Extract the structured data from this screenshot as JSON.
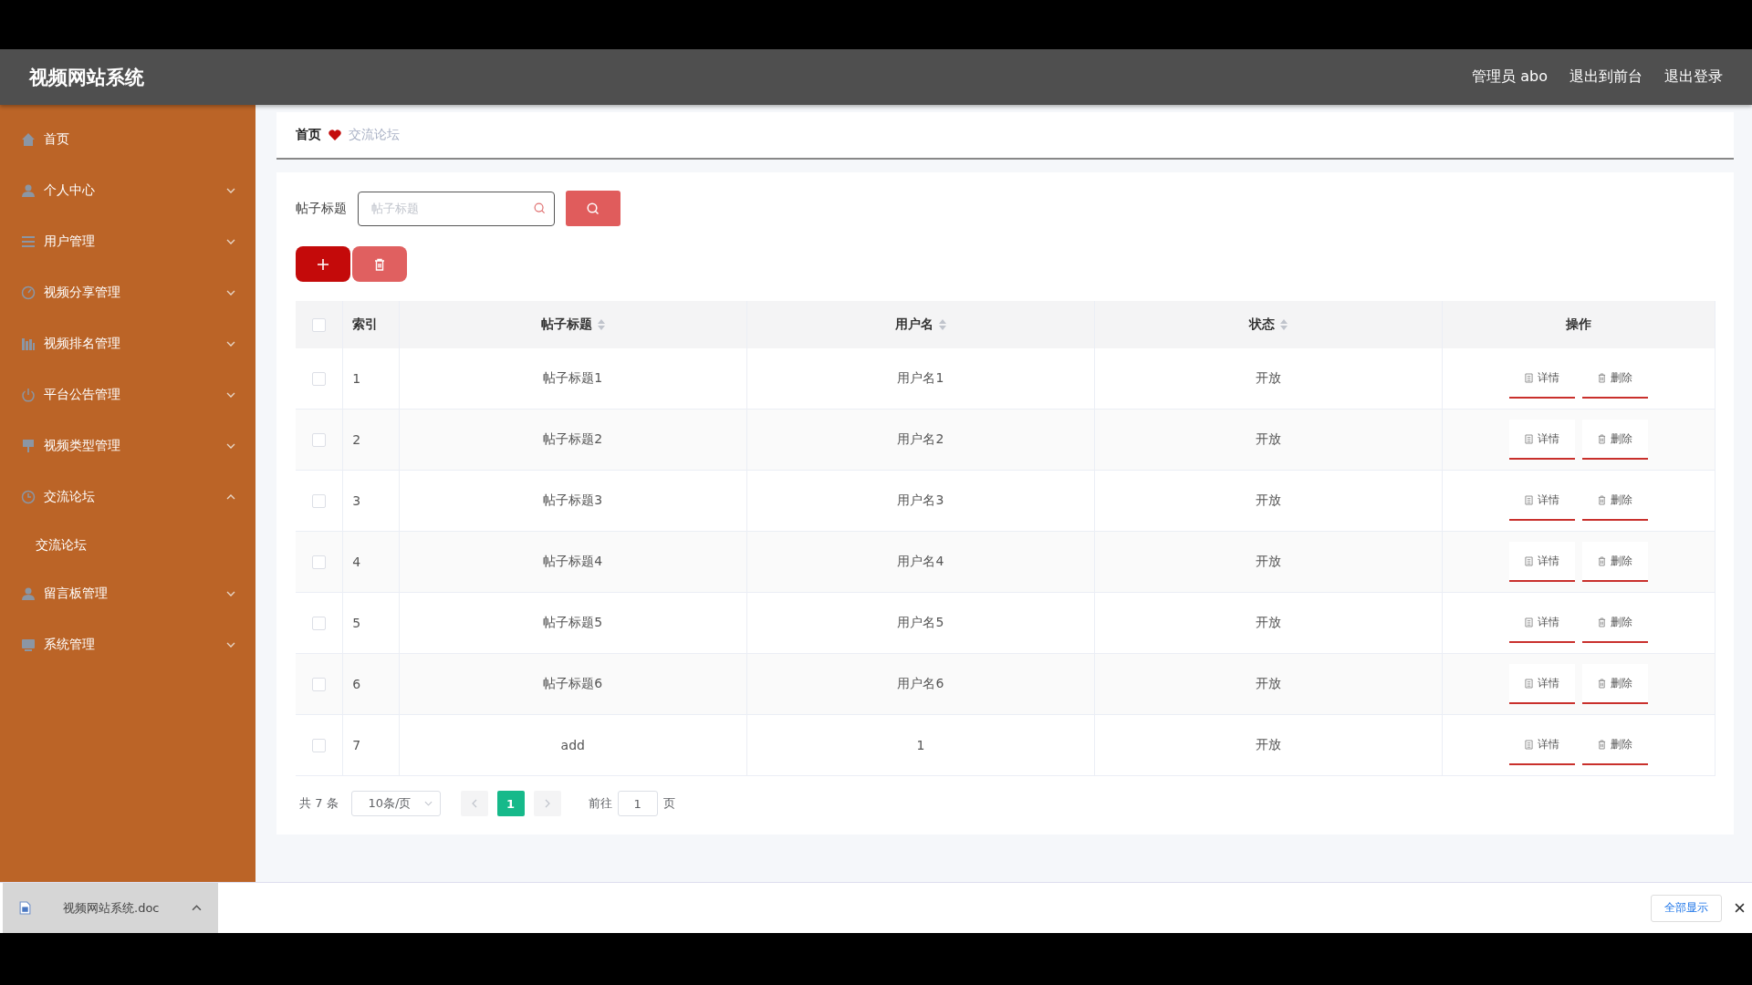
{
  "header": {
    "title": "视频网站系统",
    "user": "管理员 abo",
    "links": [
      "退出到前台",
      "退出登录"
    ]
  },
  "sidebar": {
    "items": [
      {
        "label": "首页"
      },
      {
        "label": "个人中心",
        "expanded": false
      },
      {
        "label": "用户管理",
        "expanded": false
      },
      {
        "label": "视频分享管理",
        "expanded": false
      },
      {
        "label": "视频排名管理",
        "expanded": false
      },
      {
        "label": "平台公告管理",
        "expanded": false
      },
      {
        "label": "视频类型管理",
        "expanded": false
      },
      {
        "label": "交流论坛",
        "expanded": true,
        "children": [
          {
            "label": "交流论坛"
          }
        ]
      },
      {
        "label": "留言板管理",
        "expanded": false
      },
      {
        "label": "系统管理",
        "expanded": false
      }
    ]
  },
  "breadcrumb": [
    "首页",
    "交流论坛"
  ],
  "search": {
    "label": "帖子标题",
    "placeholder": "帖子标题"
  },
  "table": {
    "header_checked": false,
    "columns": [
      {
        "label": "索引",
        "sortable": false
      },
      {
        "label": "帖子标题",
        "sortable": true
      },
      {
        "label": "用户名",
        "sortable": true
      },
      {
        "label": "状态",
        "sortable": true
      },
      {
        "label": "操作",
        "sortable": false
      }
    ],
    "rows": [
      {
        "checked": false,
        "cells": [
          "1",
          "帖子标题1",
          "用户名1",
          "开放"
        ],
        "actions": [
          "详情",
          "删除"
        ]
      },
      {
        "checked": false,
        "cells": [
          "2",
          "帖子标题2",
          "用户名2",
          "开放"
        ],
        "actions": [
          "详情",
          "删除"
        ]
      },
      {
        "checked": false,
        "cells": [
          "3",
          "帖子标题3",
          "用户名3",
          "开放"
        ],
        "actions": [
          "详情",
          "删除"
        ]
      },
      {
        "checked": false,
        "cells": [
          "4",
          "帖子标题4",
          "用户名4",
          "开放"
        ],
        "actions": [
          "详情",
          "删除"
        ]
      },
      {
        "checked": false,
        "cells": [
          "5",
          "帖子标题5",
          "用户名5",
          "开放"
        ],
        "actions": [
          "详情",
          "删除"
        ]
      },
      {
        "checked": false,
        "cells": [
          "6",
          "帖子标题6",
          "用户名6",
          "开放"
        ],
        "actions": [
          "详情",
          "删除"
        ]
      },
      {
        "checked": false,
        "cells": [
          "7",
          "add",
          "1",
          "开放"
        ],
        "actions": [
          "详情",
          "删除"
        ]
      }
    ]
  },
  "pagination": {
    "total": "共 7 条",
    "page_size": "10条/页",
    "pages": [
      {
        "label": "1",
        "selected": true
      }
    ],
    "goto_label": "前往",
    "goto_value": "1",
    "page_suffix": "页"
  },
  "download_bar": {
    "file": "视频网站系统.doc",
    "show_all": "全部显示"
  }
}
